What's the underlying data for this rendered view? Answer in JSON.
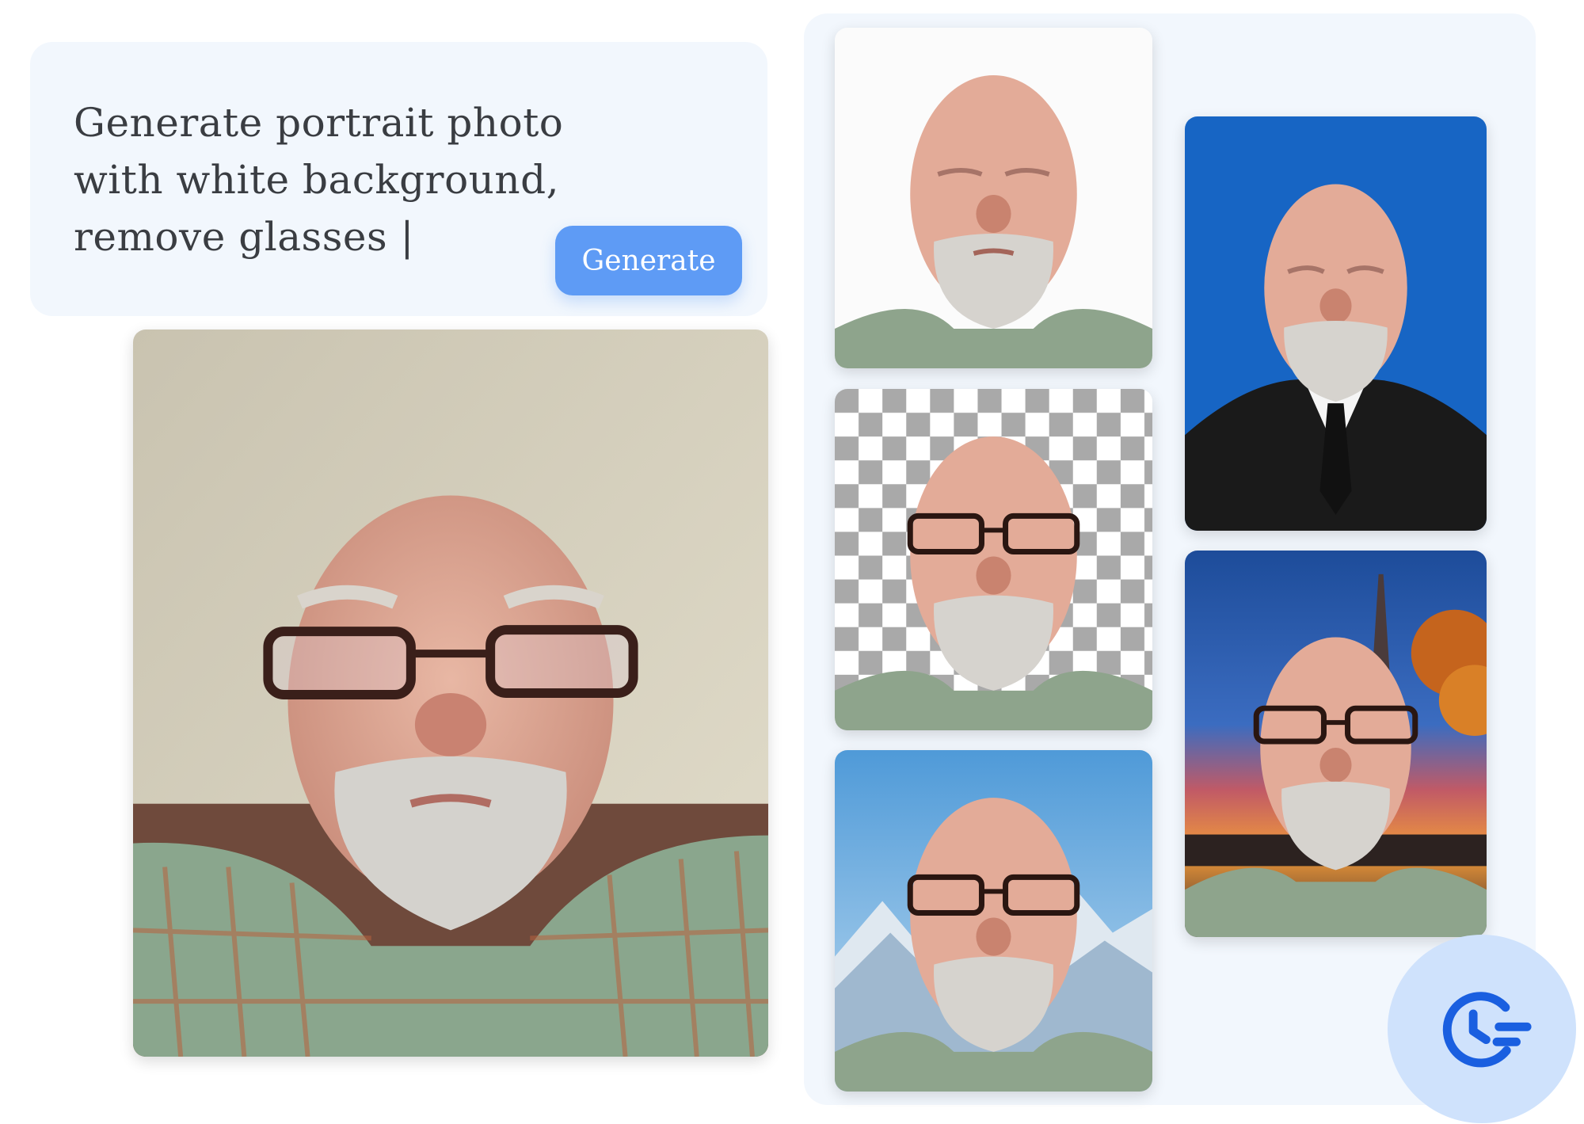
{
  "prompt": {
    "lines": [
      "Generate portrait photo",
      "with white background,",
      "remove glasses |"
    ]
  },
  "generate_button": {
    "label": "Generate"
  },
  "photos": {
    "original": {
      "icon": "portrait-original-selfie-photo"
    },
    "results": [
      {
        "icon": "portrait-white-background-photo"
      },
      {
        "icon": "portrait-transparent-background-photo"
      },
      {
        "icon": "portrait-mountain-background-photo"
      },
      {
        "icon": "portrait-blue-background-suit-photo"
      },
      {
        "icon": "portrait-sunset-eiffel-background-photo"
      }
    ]
  },
  "history_button": {
    "icon": "history-clock-icon"
  },
  "colors": {
    "card_background": "#f2f7fd",
    "button_blue": "#5e9bf5",
    "history_icon_blue": "#1a5fe0",
    "history_circle": "#cfe2fc",
    "text_dark": "#3a3d42"
  }
}
